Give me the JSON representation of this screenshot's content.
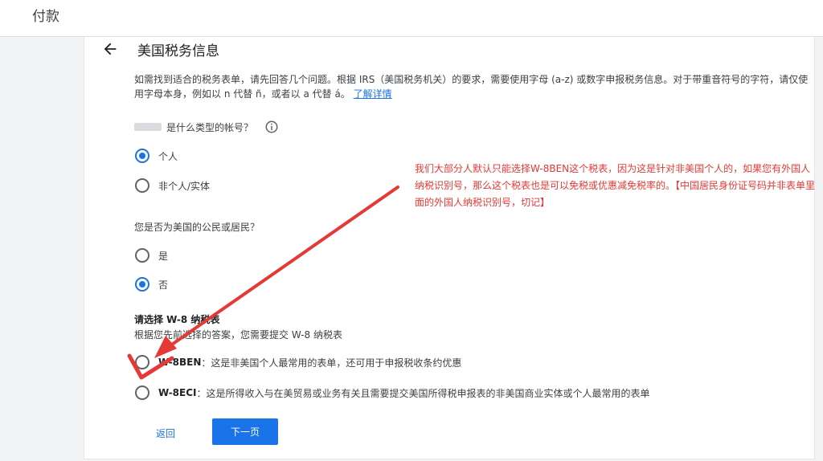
{
  "header": {
    "title": "付款"
  },
  "page": {
    "heading": "美国税务信息",
    "intro_text": "如需找到适合的税务表单，请先回答几个问题。根据 IRS（美国税务机关）的要求，需要使用字母 (a-z) 或数字申报税务信息。对于带重音符号的字符，请仅使用字母本身，例如以 n 代替 ñ，或者以 a 代替 á。",
    "learn_more": "了解详情"
  },
  "question1": {
    "label": "是什么类型的帐号？",
    "options": [
      {
        "label": "个人",
        "selected": true
      },
      {
        "label": "非个人/实体",
        "selected": false
      }
    ]
  },
  "question2": {
    "label": "您是否为美国的公民或居民？",
    "options": [
      {
        "label": "是",
        "selected": false
      },
      {
        "label": "否",
        "selected": true
      }
    ]
  },
  "form_select": {
    "title": "请选择 W-8 纳税表",
    "subtitle": "根据您先前选择的答案，您需要提交 W-8 纳税表",
    "options": [
      {
        "code": "W-8BEN",
        "desc": "：这是非美国个人最常用的表单，还可用于申报税收条约优惠",
        "selected": false
      },
      {
        "code": "W-8ECI",
        "desc": "：这是所得收入与在美贸易或业务有关且需要提交美国所得税申报表的非美国商业实体或个人最常用的表单",
        "selected": false
      }
    ]
  },
  "actions": {
    "back": "返回",
    "next": "下一页"
  },
  "annotation": {
    "text": "我们大部分人默认只能选择W-8BEN这个税表，因为这是针对非美国个人的，如果您有外国人纳税识别号，那么这个税表也是可以免税或优惠减免税率的。【中国居民身份证号码并非表单里面的外国人纳税识别号，切记】",
    "color": "#e53935"
  },
  "colors": {
    "accent": "#1a73e8",
    "annotation": "#e53935"
  }
}
